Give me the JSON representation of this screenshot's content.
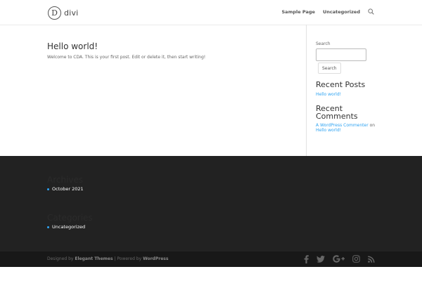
{
  "header": {
    "logo_letter": "D",
    "logo_text": "divi",
    "nav": [
      {
        "label": "Sample Page"
      },
      {
        "label": "Uncategorized"
      }
    ],
    "search_icon": "search-icon"
  },
  "main": {
    "post_title": "Hello world!",
    "post_excerpt": "Welcome to CDA. This is your first post. Edit or delete it, then start writing!"
  },
  "sidebar": {
    "search_label": "Search",
    "search_value": "",
    "search_button": "Search",
    "recent_posts_title": "Recent Posts",
    "recent_posts": [
      "Hello world!"
    ],
    "recent_comments_title": "Recent Comments",
    "recent_comment_author": "A WordPress Commenter",
    "recent_comment_on": "on",
    "recent_comment_post": "Hello world!"
  },
  "footer": {
    "archives_title": "Archives",
    "archive_item": "October 2021",
    "categories_title": "Categories",
    "category_item": "Uncategorized",
    "bullet_color": "#2ea3f2"
  },
  "bottom": {
    "designed_by": "Designed by",
    "elegant_themes": "Elegant Themes",
    "separator": " | Powered by ",
    "wordpress": "WordPress",
    "social_icons": [
      "facebook-icon",
      "twitter-icon",
      "google-plus-icon",
      "instagram-icon",
      "rss-icon"
    ]
  },
  "colors": {
    "accent": "#2ea3f2",
    "footer_bg": "#222222",
    "bottom_bar_bg": "#181818"
  }
}
